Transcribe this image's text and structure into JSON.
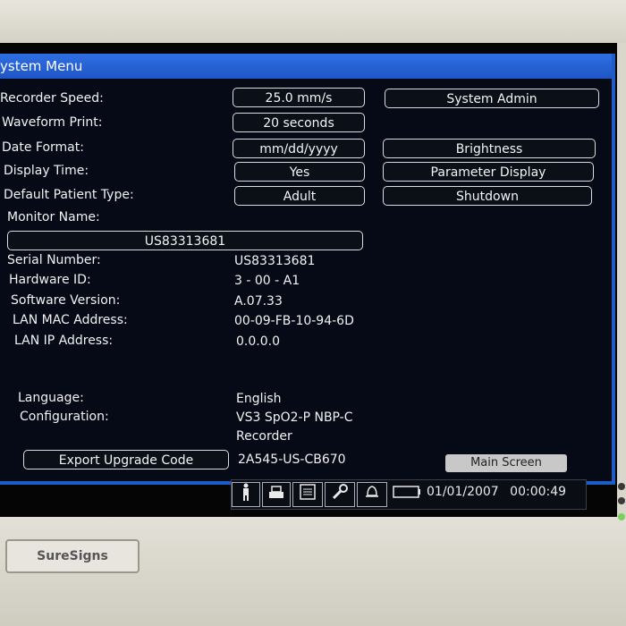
{
  "window": {
    "title": "ystem Menu"
  },
  "settings": [
    {
      "label": "Recorder Speed:",
      "value": "25.0 mm/s"
    },
    {
      "label": "Waveform Print:",
      "value": "20 seconds"
    },
    {
      "label": "Date Format:",
      "value": "mm/dd/yyyy"
    },
    {
      "label": "Display Time:",
      "value": "Yes"
    },
    {
      "label": "Default Patient Type:",
      "value": "Adult"
    }
  ],
  "monitor_name": {
    "label": "Monitor Name:",
    "value": "US83313681"
  },
  "info": [
    {
      "label": "Serial Number:",
      "value": "US83313681"
    },
    {
      "label": "Hardware ID:",
      "value": "3 - 00 - A1"
    },
    {
      "label": "Software Version:",
      "value": "A.07.33"
    },
    {
      "label": "LAN MAC Address:",
      "value": "00-09-FB-10-94-6D"
    },
    {
      "label": "LAN IP Address:",
      "value": "0.0.0.0"
    }
  ],
  "language": {
    "label": "Language:",
    "value": "English"
  },
  "configuration": {
    "label": "Configuration:",
    "value_line1": "VS3 SpO2-P NBP-C",
    "value_line2": "Recorder"
  },
  "upgrade": {
    "button": "Export Upgrade Code",
    "code": "2A545-US-CB670"
  },
  "side_buttons": [
    "System Admin",
    "Brightness",
    "Parameter Display",
    "Shutdown"
  ],
  "main_screen_button": "Main Screen",
  "status_bar": {
    "date": "01/01/2007",
    "time": "00:00:49"
  },
  "brand": "SureSigns",
  "icons": [
    "patient-icon",
    "printer-icon",
    "report-icon",
    "wrench-icon",
    "alarm-bell-icon",
    "battery-icon"
  ]
}
